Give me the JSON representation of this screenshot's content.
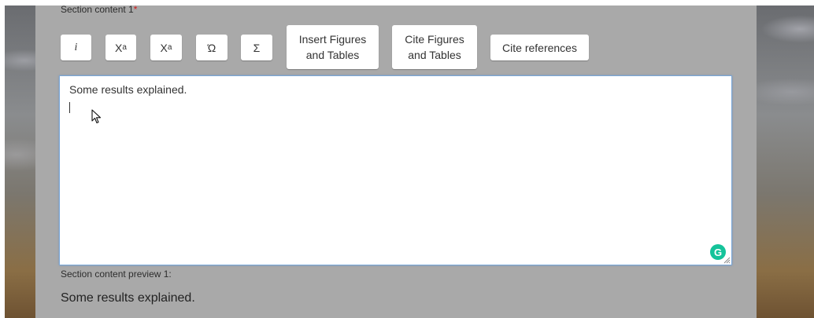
{
  "section": {
    "label": "Section content 1",
    "required_marker": "*"
  },
  "toolbar": {
    "italic_label": "i",
    "superscript_base": "X",
    "superscript_exp": "a",
    "subscript_base": "X",
    "subscript_sub": "a",
    "omega_label": "Ώ",
    "sigma_label": "Σ",
    "insert_figures_line1": "Insert Figures",
    "insert_figures_line2": "and Tables",
    "cite_figures_line1": "Cite Figures",
    "cite_figures_line2": "and Tables",
    "cite_references_label": "Cite references"
  },
  "editor": {
    "value": "Some results explained."
  },
  "preview": {
    "label": "Section content preview 1:",
    "text": "Some results explained."
  },
  "icons": {
    "grammarly": "grammarly-icon",
    "grammarly_letter": "G",
    "cursor": "mouse-pointer-icon",
    "resize": "resize-handle-icon"
  },
  "colors": {
    "panel": "#a9a9a9",
    "required": "#d11a1a",
    "editor_border": "#7aa7d8",
    "grammarly": "#15c39a"
  }
}
